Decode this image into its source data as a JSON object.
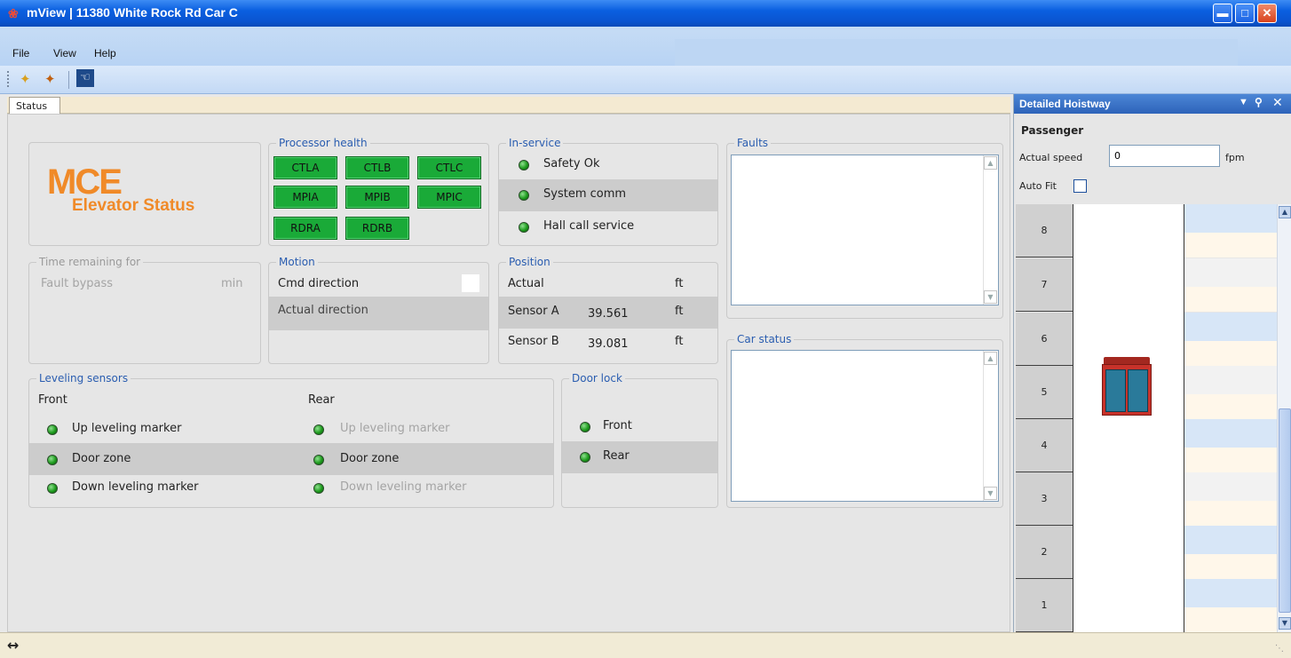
{
  "window": {
    "title": "mView | 11380 White Rock Rd Car C"
  },
  "menu": {
    "file": "File",
    "view": "View",
    "help": "Help"
  },
  "tabs": {
    "status": "Status"
  },
  "logo": {
    "brand": "MCE",
    "subtitle": "Elevator Status",
    "brand_color": "#f08a28"
  },
  "processor_health": {
    "title": "Processor health",
    "chips": [
      "CTLA",
      "CTLB",
      "CTLC",
      "MPIA",
      "MPIB",
      "MPIC",
      "RDRA",
      "RDRB"
    ],
    "chip_color": "#1aaa38"
  },
  "in_service": {
    "title": "In-service",
    "items": [
      "Safety Ok",
      "System comm",
      "Hall call service"
    ]
  },
  "faults": {
    "title": "Faults"
  },
  "time_remaining": {
    "title": "Time remaining for",
    "label": "Fault bypass",
    "unit": "min"
  },
  "motion": {
    "title": "Motion",
    "cmd_direction": "Cmd direction",
    "actual_direction": "Actual direction"
  },
  "position": {
    "title": "Position",
    "actual_label": "Actual",
    "actual_unit": "ft",
    "sensor_a_label": "Sensor A",
    "sensor_a_value": "39.561",
    "sensor_a_unit": "ft",
    "sensor_b_label": "Sensor B",
    "sensor_b_value": "39.081",
    "sensor_b_unit": "ft"
  },
  "car_status": {
    "title": "Car status"
  },
  "leveling": {
    "title": "Leveling sensors",
    "front_label": "Front",
    "rear_label": "Rear",
    "front_items": [
      "Up leveling marker",
      "Door zone",
      "Down leveling marker"
    ],
    "rear_items": [
      "Up leveling marker",
      "Door zone",
      "Down leveling marker"
    ]
  },
  "door_lock": {
    "title": "Door lock",
    "items": [
      "Front",
      "Rear"
    ]
  },
  "hoistway": {
    "title": "Detailed Hoistway",
    "mode": "Passenger",
    "speed_label": "Actual speed",
    "speed_value": "0",
    "speed_unit": "fpm",
    "autofit_label": "Auto Fit",
    "floors": [
      "8",
      "7",
      "6",
      "5",
      "4",
      "3",
      "2",
      "1"
    ],
    "car_color": "#c8322a",
    "door_color": "#2a7a9a"
  }
}
